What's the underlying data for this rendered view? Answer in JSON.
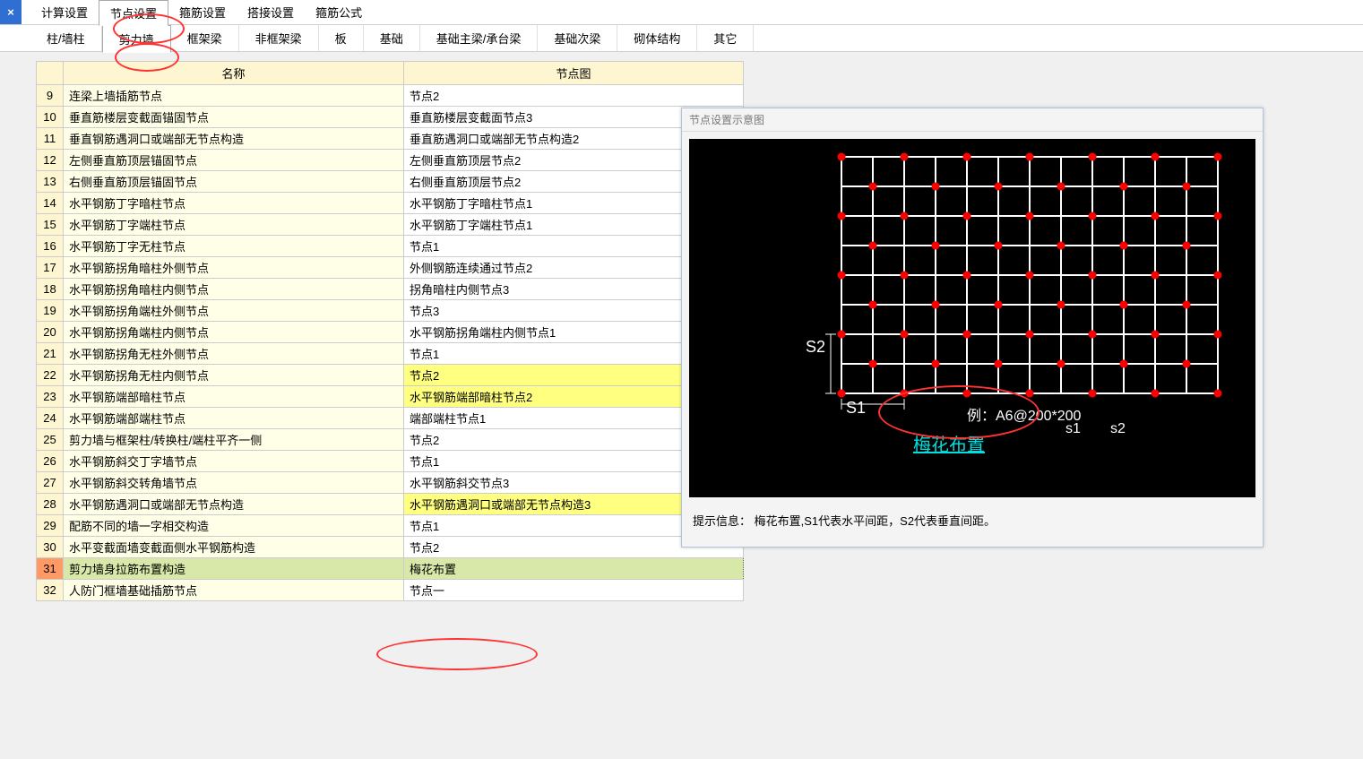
{
  "close_label": "×",
  "top_tabs": [
    "计算设置",
    "节点设置",
    "箍筋设置",
    "搭接设置",
    "箍筋公式"
  ],
  "top_active": 1,
  "sub_tabs": [
    "柱/墙柱",
    "剪力墙",
    "框架梁",
    "非框架梁",
    "板",
    "基础",
    "基础主梁/承台梁",
    "基础次梁",
    "砌体结构",
    "其它"
  ],
  "sub_active": 1,
  "table_headers": {
    "name": "名称",
    "diagram": "节点图"
  },
  "rows": [
    {
      "n": 9,
      "name": "连梁上墙插筋节点",
      "val": "节点2"
    },
    {
      "n": 10,
      "name": "垂直筋楼层变截面锚固节点",
      "val": "垂直筋楼层变截面节点3"
    },
    {
      "n": 11,
      "name": "垂直钢筋遇洞口或端部无节点构造",
      "val": "垂直筋遇洞口或端部无节点构造2"
    },
    {
      "n": 12,
      "name": "左侧垂直筋顶层锚固节点",
      "val": "左侧垂直筋顶层节点2"
    },
    {
      "n": 13,
      "name": "右侧垂直筋顶层锚固节点",
      "val": "右侧垂直筋顶层节点2"
    },
    {
      "n": 14,
      "name": "水平钢筋丁字暗柱节点",
      "val": "水平钢筋丁字暗柱节点1"
    },
    {
      "n": 15,
      "name": "水平钢筋丁字端柱节点",
      "val": "水平钢筋丁字端柱节点1"
    },
    {
      "n": 16,
      "name": "水平钢筋丁字无柱节点",
      "val": "节点1"
    },
    {
      "n": 17,
      "name": "水平钢筋拐角暗柱外侧节点",
      "val": "外侧钢筋连续通过节点2"
    },
    {
      "n": 18,
      "name": "水平钢筋拐角暗柱内侧节点",
      "val": "拐角暗柱内侧节点3"
    },
    {
      "n": 19,
      "name": "水平钢筋拐角端柱外侧节点",
      "val": "节点3"
    },
    {
      "n": 20,
      "name": "水平钢筋拐角端柱内侧节点",
      "val": "水平钢筋拐角端柱内侧节点1"
    },
    {
      "n": 21,
      "name": "水平钢筋拐角无柱外侧节点",
      "val": "节点1"
    },
    {
      "n": 22,
      "name": "水平钢筋拐角无柱内侧节点",
      "val": "节点2",
      "hl": true
    },
    {
      "n": 23,
      "name": "水平钢筋端部暗柱节点",
      "val": "水平钢筋端部暗柱节点2",
      "hl": true
    },
    {
      "n": 24,
      "name": "水平钢筋端部端柱节点",
      "val": "端部端柱节点1"
    },
    {
      "n": 25,
      "name": "剪力墙与框架柱/转换柱/端柱平齐一侧",
      "val": "节点2"
    },
    {
      "n": 26,
      "name": "水平钢筋斜交丁字墙节点",
      "val": "节点1"
    },
    {
      "n": 27,
      "name": "水平钢筋斜交转角墙节点",
      "val": "水平钢筋斜交节点3"
    },
    {
      "n": 28,
      "name": "水平钢筋遇洞口或端部无节点构造",
      "val": "水平钢筋遇洞口或端部无节点构造3",
      "hl": true
    },
    {
      "n": 29,
      "name": "配筋不同的墙一字相交构造",
      "val": "节点1"
    },
    {
      "n": 30,
      "name": "水平变截面墙变截面侧水平钢筋构造",
      "val": "节点2"
    },
    {
      "n": 31,
      "name": "剪力墙身拉筋布置构造",
      "val": "梅花布置",
      "sel": true
    },
    {
      "n": 32,
      "name": "人防门框墙基础插筋节点",
      "val": "节点一"
    }
  ],
  "preview": {
    "title": "节点设置示意图",
    "s1": "S1",
    "s2": "S2",
    "example": "例：A6@200*200",
    "sub1": "s1",
    "sub2": "s2",
    "pattern_name": "梅花布置",
    "hint_label": "提示信息：",
    "hint_text": "梅花布置,S1代表水平间距，S2代表垂直间距。"
  }
}
